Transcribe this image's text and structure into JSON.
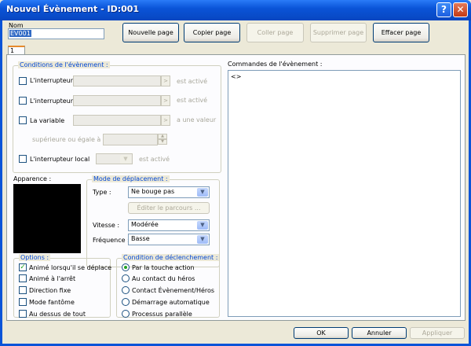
{
  "window": {
    "title": "Nouvel Évènement - ID:001",
    "help_icon": "help-icon",
    "close_icon": "close-icon",
    "help_glyph": "?",
    "close_glyph": "✕"
  },
  "name": {
    "label": "Nom",
    "value": "EV001"
  },
  "toolbar": {
    "new_page": "Nouvelle page",
    "copy_page": "Copier page",
    "paste_page": "Coller page",
    "delete_page": "Supprimer page",
    "clear_page": "Effacer page"
  },
  "tabs": [
    {
      "label": "1"
    }
  ],
  "conditions": {
    "title": "Conditions de l'évènement :",
    "switch1_label": "L'interrupteur",
    "switch1_suffix": "est activé",
    "switch2_label": "L'interrupteur",
    "switch2_suffix": "est activé",
    "variable_label": "La variable",
    "variable_suffix": "a une valeur",
    "greater_equal_label": "supérieure ou égale à",
    "local_switch_label": "L'interrupteur local",
    "local_switch_suffix": "est activé",
    "picker_glyph": ">",
    "spin_up": "▲",
    "spin_down": "▼"
  },
  "appearance": {
    "title": "Apparence :"
  },
  "movement": {
    "title": "Mode de déplacement :",
    "type_label": "Type :",
    "type_value": "Ne bouge pas",
    "edit_route": "Éditer le parcours ...",
    "speed_label": "Vitesse :",
    "speed_value": "Modérée",
    "frequency_label": "Fréquence :",
    "frequency_value": "Basse",
    "dropdown_glyph": "▼"
  },
  "options": {
    "title": "Options :",
    "items": [
      {
        "label": "Animé lorsqu'il se déplace",
        "checked": true
      },
      {
        "label": "Animé à l'arrêt",
        "checked": false
      },
      {
        "label": "Direction fixe",
        "checked": false
      },
      {
        "label": "Mode fantôme",
        "checked": false
      },
      {
        "label": "Au dessus de tout",
        "checked": false
      }
    ]
  },
  "trigger": {
    "title": "Condition de déclenchement :",
    "items": [
      {
        "label": "Par la touche action",
        "selected": true
      },
      {
        "label": "Au contact du héros",
        "selected": false
      },
      {
        "label": "Contact Évènement/Héros",
        "selected": false
      },
      {
        "label": "Démarrage automatique",
        "selected": false
      },
      {
        "label": "Processus parallèle",
        "selected": false
      }
    ]
  },
  "commands": {
    "title": "Commandes de l'évènement :",
    "first_line": "<>"
  },
  "footer": {
    "ok": "OK",
    "cancel": "Annuler",
    "apply": "Appliquer"
  }
}
